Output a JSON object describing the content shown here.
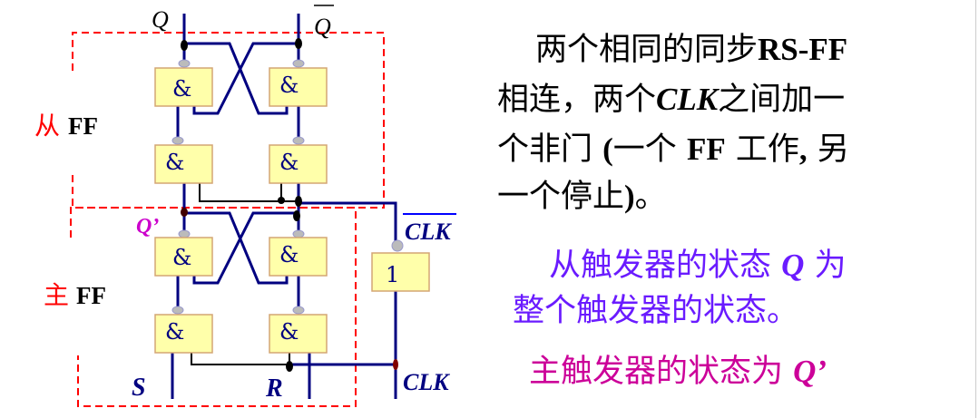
{
  "diagram": {
    "labels": {
      "q": "Q",
      "q_bar": "Q",
      "q_prime": "Q’",
      "slave_ff_cn": "从",
      "slave_ff_en": "FF",
      "master_ff_cn": "主",
      "master_ff_en": "FF",
      "s": "S",
      "r": "R",
      "clk": "CLK",
      "clk_bar": "CLK"
    },
    "gate_and_symbol": "&",
    "gate_not_symbol": "1",
    "colors": {
      "wire": "#000080",
      "gate_fill": "#ffffaa",
      "gate_border": "#d4a574",
      "dash": "#ff0000",
      "bubble": "#bbbbbb"
    }
  },
  "text": {
    "para1": {
      "l1a": "两个相同的同步",
      "l1b": "RS-FF",
      "l2a": "相连，两个",
      "l2b": "CLK",
      "l2c": "之间加一",
      "l3a": "个非门 ",
      "l3b": "(",
      "l3c": "一个 ",
      "l3d": "FF",
      "l3e": " 工作",
      "l3f": ",",
      "l3g": " 另",
      "l4a": "一个停止",
      "l4b": ")",
      "l4c": "。"
    },
    "para2": {
      "l1a": "从触发器的状态 ",
      "l1b": "Q",
      "l1c": " 为",
      "l2": "整个触发器的状态。"
    },
    "para3": {
      "a": "主触发器的状态为 ",
      "b": "Q’"
    }
  }
}
